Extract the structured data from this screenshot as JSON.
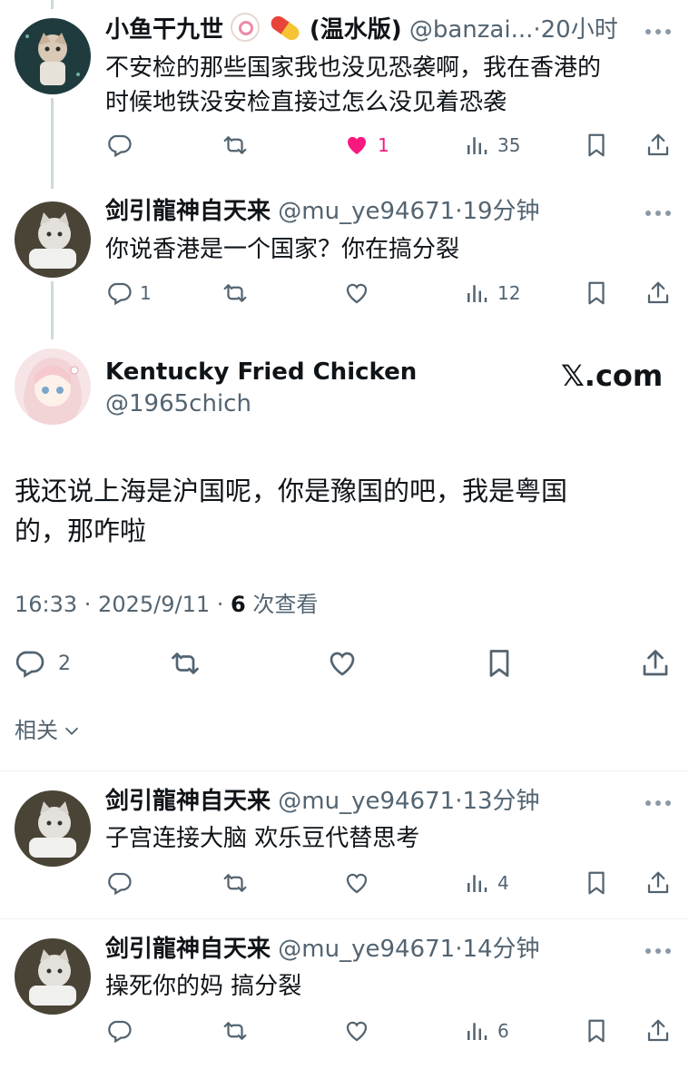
{
  "tweets": [
    {
      "name": "小鱼干九世",
      "name_suffix": "(温水版)",
      "handle": "@banzai...",
      "time": "20小时",
      "text_line1": "不安检的那些国家我也没见恐袭啊，我在香港的",
      "text_line2": "时候地铁没安检直接过怎么没见着恐袭",
      "replies": "",
      "likes": "1",
      "views": "35"
    },
    {
      "name": "剑引龍神自天来",
      "handle": "@mu_ye94671",
      "time": "19分钟",
      "text_line1": "你说香港是一个国家？你在搞分裂",
      "replies": "1",
      "likes": "",
      "views": "12"
    }
  ],
  "main": {
    "name": "Kentucky Fried Chicken",
    "handle": "@1965chich",
    "watermark": "𝕏.com",
    "text_line1": "我还说上海是沪国呢，你是豫国的吧，我是粤国",
    "text_line2": "的，那咋啦",
    "timestamp": "16:33 · 2025/9/11 · ",
    "view_count": "6",
    "view_label": " 次查看",
    "replies": "2"
  },
  "related": {
    "label": "相关"
  },
  "related_tweets": [
    {
      "name": "剑引龍神自天来",
      "handle": "@mu_ye94671",
      "time": "13分钟",
      "text_line1": "子宫连接大脑 欢乐豆代替思考",
      "views": "4"
    },
    {
      "name": "剑引龍神自天来",
      "handle": "@mu_ye94671",
      "time": "14分钟",
      "text_line1": "操死你的妈 搞分裂",
      "views": "6"
    }
  ],
  "colors": {
    "like": "#f91880",
    "muted": "#536471",
    "line": "#cfd9de"
  }
}
